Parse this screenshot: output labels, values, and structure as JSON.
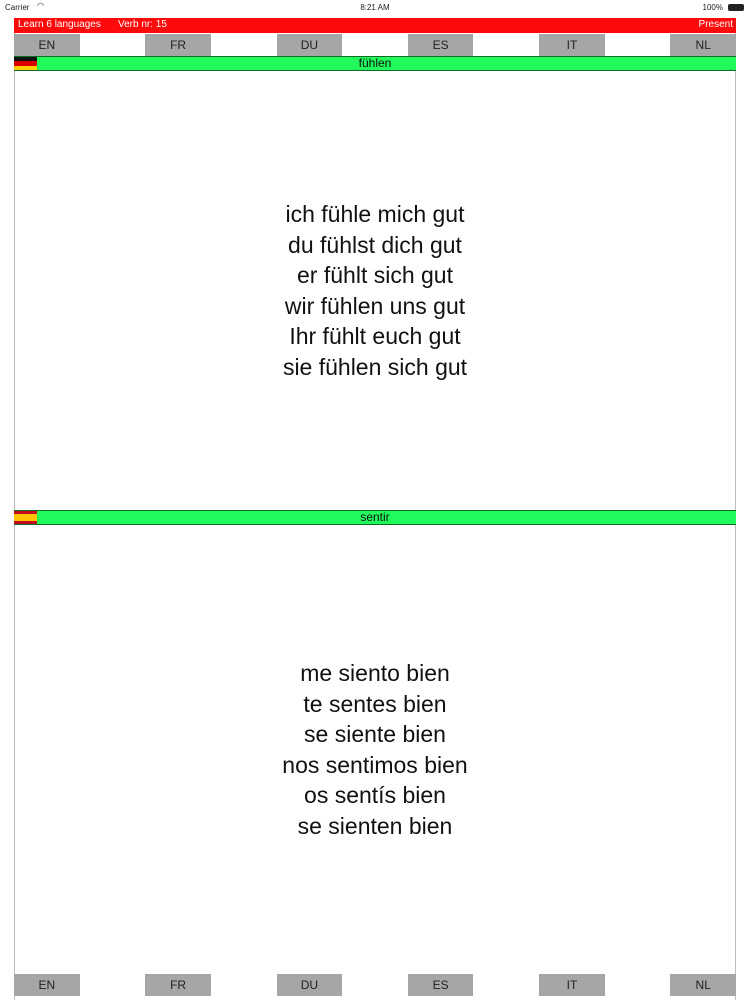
{
  "status_bar": {
    "carrier": "Carrier",
    "time": "8:21 AM",
    "battery": "100%"
  },
  "header": {
    "app_title": "Learn 6 languages",
    "verb_label": "Verb nr:  15",
    "tense": "Present",
    "color": "#ff0a0a"
  },
  "languages_top": [
    "EN",
    "FR",
    "DU",
    "ES",
    "IT",
    "NL"
  ],
  "languages_bottom": [
    "EN",
    "FR",
    "DU",
    "ES",
    "IT",
    "NL"
  ],
  "source": {
    "flag": "german-flag-icon",
    "verb": "fühlen",
    "lines": [
      "ich fühle mich gut",
      "du fühlst dich gut",
      "er fühlt sich gut",
      "wir fühlen uns gut",
      "Ihr fühlt euch gut",
      "sie fühlen sich gut"
    ]
  },
  "target": {
    "flag": "spanish-flag-icon",
    "verb": "sentir",
    "lines": [
      "me siento bien",
      "te sentes bien",
      "se siente bien",
      "nos sentimos bien",
      "os sentís bien",
      "se sienten bien"
    ]
  },
  "colors": {
    "verb_bar": "#22f95b",
    "lang_button": "#a6a6a6"
  }
}
